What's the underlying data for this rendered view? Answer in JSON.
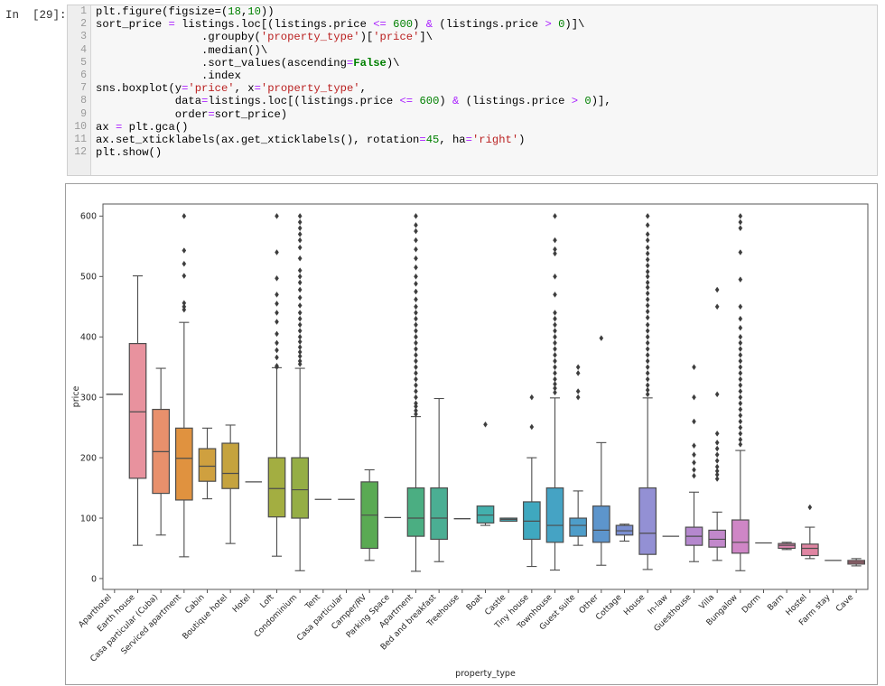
{
  "notebook": {
    "prompt": "In  [29]:",
    "line_numbers": [
      "1",
      "2",
      "3",
      "4",
      "5",
      "6",
      "7",
      "8",
      "9",
      "10",
      "11",
      "12"
    ],
    "code_lines": [
      [
        {
          "t": "plt.figure(figsize=",
          "c": "p"
        },
        {
          "t": "(",
          "c": "p"
        },
        {
          "t": "18",
          "c": "n"
        },
        {
          "t": ",",
          "c": "p"
        },
        {
          "t": "10",
          "c": "n"
        },
        {
          "t": "))",
          "c": "p"
        }
      ],
      [
        {
          "t": "sort_price ",
          "c": "p"
        },
        {
          "t": "=",
          "c": "o"
        },
        {
          "t": " listings.loc[(listings.price ",
          "c": "p"
        },
        {
          "t": "<=",
          "c": "o"
        },
        {
          "t": " ",
          "c": "p"
        },
        {
          "t": "600",
          "c": "n"
        },
        {
          "t": ") ",
          "c": "p"
        },
        {
          "t": "&",
          "c": "o"
        },
        {
          "t": " (listings.price ",
          "c": "p"
        },
        {
          "t": ">",
          "c": "o"
        },
        {
          "t": " ",
          "c": "p"
        },
        {
          "t": "0",
          "c": "n"
        },
        {
          "t": ")]\\",
          "c": "p"
        }
      ],
      [
        {
          "t": "                .groupby(",
          "c": "p"
        },
        {
          "t": "'property_type'",
          "c": "s"
        },
        {
          "t": ")[",
          "c": "p"
        },
        {
          "t": "'price'",
          "c": "s"
        },
        {
          "t": "]\\",
          "c": "p"
        }
      ],
      [
        {
          "t": "                .median()\\",
          "c": "p"
        }
      ],
      [
        {
          "t": "                .sort_values(ascending",
          "c": "p"
        },
        {
          "t": "=",
          "c": "o"
        },
        {
          "t": "False",
          "c": "k"
        },
        {
          "t": ")\\",
          "c": "p"
        }
      ],
      [
        {
          "t": "                .index",
          "c": "p"
        }
      ],
      [
        {
          "t": "sns.boxplot(y",
          "c": "p"
        },
        {
          "t": "=",
          "c": "o"
        },
        {
          "t": "'price'",
          "c": "s"
        },
        {
          "t": ", x",
          "c": "p"
        },
        {
          "t": "=",
          "c": "o"
        },
        {
          "t": "'property_type'",
          "c": "s"
        },
        {
          "t": ",",
          "c": "p"
        }
      ],
      [
        {
          "t": "            data",
          "c": "p"
        },
        {
          "t": "=",
          "c": "o"
        },
        {
          "t": "listings.loc[(listings.price ",
          "c": "p"
        },
        {
          "t": "<=",
          "c": "o"
        },
        {
          "t": " ",
          "c": "p"
        },
        {
          "t": "600",
          "c": "n"
        },
        {
          "t": ") ",
          "c": "p"
        },
        {
          "t": "&",
          "c": "o"
        },
        {
          "t": " (listings.price ",
          "c": "p"
        },
        {
          "t": ">",
          "c": "o"
        },
        {
          "t": " ",
          "c": "p"
        },
        {
          "t": "0",
          "c": "n"
        },
        {
          "t": ")],",
          "c": "p"
        }
      ],
      [
        {
          "t": "            order",
          "c": "p"
        },
        {
          "t": "=",
          "c": "o"
        },
        {
          "t": "sort_price)",
          "c": "p"
        }
      ],
      [
        {
          "t": "ax ",
          "c": "p"
        },
        {
          "t": "=",
          "c": "o"
        },
        {
          "t": " plt.gca()",
          "c": "p"
        }
      ],
      [
        {
          "t": "ax.set_xticklabels(ax.get_xticklabels(), rotation",
          "c": "p"
        },
        {
          "t": "=",
          "c": "o"
        },
        {
          "t": "45",
          "c": "n"
        },
        {
          "t": ", ha",
          "c": "p"
        },
        {
          "t": "=",
          "c": "o"
        },
        {
          "t": "'right'",
          "c": "s"
        },
        {
          "t": ")",
          "c": "p"
        }
      ],
      [
        {
          "t": "plt.show()",
          "c": "p"
        }
      ]
    ]
  },
  "chart_data": {
    "type": "box",
    "title": "",
    "xlabel": "property_type",
    "ylabel": "price",
    "ylim": [
      -18,
      620
    ],
    "yticks": [
      0,
      100,
      200,
      300,
      400,
      500,
      600
    ],
    "grid": false,
    "categories": [
      "Aparthotel",
      "Earth house",
      "Casa particular (Cuba)",
      "Serviced apartment",
      "Cabin",
      "Boutique hotel",
      "Hotel",
      "Loft",
      "Condominium",
      "Tent",
      "Casa particular",
      "Camper/RV",
      "Parking Space",
      "Apartment",
      "Bed and breakfast",
      "Treehouse",
      "Boat",
      "Castle",
      "Tiny house",
      "Townhouse",
      "Guest suite",
      "Other",
      "Cottage",
      "House",
      "In-law",
      "Guesthouse",
      "Villa",
      "Bungalow",
      "Dorm",
      "Barn",
      "Hostel",
      "Farm stay",
      "Cave"
    ],
    "colors": [
      "#e8929e",
      "#e8929e",
      "#e8906c",
      "#e0923f",
      "#cfa03f",
      "#c5a33e",
      "#b5ab3e",
      "#a3ae41",
      "#95ae45",
      "#7fae45",
      "#69ad4a",
      "#5aaa53",
      "#4eac6e",
      "#4bae82",
      "#4bae93",
      "#4badа3",
      "#43b0ad",
      "#3fadb8",
      "#3fa8bf",
      "#45a3c4",
      "#4e9dc9",
      "#5d95cc",
      "#7b8fd1",
      "#9390d4",
      "#a68bd2",
      "#b588ce",
      "#c288cb",
      "#cf86c6",
      "#d885bc",
      "#dd85ae",
      "#e085a2",
      "#e1859a",
      "#c96f80"
    ],
    "boxes": [
      {
        "cat": "Aparthotel",
        "q1": 305,
        "med": 305,
        "q3": 305,
        "low": 305,
        "high": 305,
        "outliers": []
      },
      {
        "cat": "Earth house",
        "q1": 166,
        "med": 276,
        "q3": 389,
        "low": 55,
        "high": 501,
        "outliers": []
      },
      {
        "cat": "Casa particular (Cuba)",
        "q1": 141,
        "med": 210,
        "q3": 280,
        "low": 72,
        "high": 348,
        "outliers": []
      },
      {
        "cat": "Serviced apartment",
        "q1": 130,
        "med": 199,
        "q3": 249,
        "low": 36,
        "high": 424,
        "outliers": [
          600,
          543,
          521,
          501,
          456,
          450,
          445
        ]
      },
      {
        "cat": "Cabin",
        "q1": 161,
        "med": 186,
        "q3": 215,
        "low": 132,
        "high": 249,
        "outliers": []
      },
      {
        "cat": "Boutique hotel",
        "q1": 149,
        "med": 174,
        "q3": 224,
        "low": 58,
        "high": 254,
        "outliers": []
      },
      {
        "cat": "Hotel",
        "q1": 160,
        "med": 160,
        "q3": 160,
        "low": 160,
        "high": 160,
        "outliers": []
      },
      {
        "cat": "Loft",
        "q1": 102,
        "med": 149,
        "q3": 200,
        "low": 37,
        "high": 349,
        "outliers": [
          600,
          540,
          497,
          470,
          455,
          440,
          425,
          405,
          390,
          378,
          366,
          352,
          350
        ]
      },
      {
        "cat": "Condominium",
        "q1": 100,
        "med": 147,
        "q3": 200,
        "low": 13,
        "high": 348,
        "outliers": [
          600,
          590,
          580,
          570,
          560,
          548,
          530,
          510,
          500,
          490,
          478,
          465,
          452,
          440,
          430,
          420,
          410,
          400,
          392,
          383,
          375,
          368,
          360,
          355
        ]
      },
      {
        "cat": "Tent",
        "q1": 131,
        "med": 131,
        "q3": 131,
        "low": 131,
        "high": 131,
        "outliers": []
      },
      {
        "cat": "Casa particular",
        "q1": 131,
        "med": 131,
        "q3": 131,
        "low": 131,
        "high": 131,
        "outliers": []
      },
      {
        "cat": "Camper/RV",
        "q1": 50,
        "med": 105,
        "q3": 160,
        "low": 30,
        "high": 180,
        "outliers": []
      },
      {
        "cat": "Parking Space",
        "q1": 101,
        "med": 101,
        "q3": 101,
        "low": 101,
        "high": 101,
        "outliers": []
      },
      {
        "cat": "Apartment",
        "q1": 70,
        "med": 100,
        "q3": 150,
        "low": 12,
        "high": 268,
        "outliers": [
          600,
          585,
          575,
          560,
          545,
          530,
          515,
          500,
          488,
          475,
          462,
          450,
          440,
          430,
          420,
          410,
          400,
          390,
          380,
          370,
          360,
          350,
          340,
          330,
          320,
          310,
          300,
          290,
          285,
          278,
          272
        ]
      },
      {
        "cat": "Bed and breakfast",
        "q1": 65,
        "med": 100,
        "q3": 150,
        "low": 28,
        "high": 298,
        "outliers": []
      },
      {
        "cat": "Treehouse",
        "q1": 99,
        "med": 99,
        "q3": 99,
        "low": 99,
        "high": 99,
        "outliers": []
      },
      {
        "cat": "Boat",
        "q1": 92,
        "med": 105,
        "q3": 120,
        "low": 88,
        "high": 120,
        "outliers": [
          255
        ]
      },
      {
        "cat": "Castle",
        "q1": 95,
        "med": 98,
        "q3": 100,
        "low": 95,
        "high": 100,
        "outliers": []
      },
      {
        "cat": "Tiny house",
        "q1": 65,
        "med": 95,
        "q3": 127,
        "low": 20,
        "high": 200,
        "outliers": [
          300,
          251
        ]
      },
      {
        "cat": "Townhouse",
        "q1": 60,
        "med": 88,
        "q3": 150,
        "low": 14,
        "high": 299,
        "outliers": [
          600,
          560,
          545,
          538,
          500,
          470,
          440,
          430,
          420,
          410,
          400,
          390,
          380,
          370,
          360,
          350,
          340,
          330,
          322,
          315,
          308
        ]
      },
      {
        "cat": "Guest suite",
        "q1": 70,
        "med": 88,
        "q3": 100,
        "low": 55,
        "high": 145,
        "outliers": [
          350,
          340,
          310,
          300
        ]
      },
      {
        "cat": "Other",
        "q1": 60,
        "med": 80,
        "q3": 120,
        "low": 22,
        "high": 225,
        "outliers": [
          398
        ]
      },
      {
        "cat": "Cottage",
        "q1": 72,
        "med": 79,
        "q3": 88,
        "low": 62,
        "high": 90,
        "outliers": []
      },
      {
        "cat": "House",
        "q1": 40,
        "med": 75,
        "q3": 150,
        "low": 15,
        "high": 299,
        "outliers": [
          600,
          585,
          570,
          560,
          548,
          538,
          528,
          518,
          508,
          500,
          490,
          482,
          472,
          462,
          452,
          442,
          432,
          420,
          410,
          400,
          390,
          380,
          370,
          360,
          350,
          340,
          330,
          320,
          312,
          305
        ]
      },
      {
        "cat": "In-law",
        "q1": 70,
        "med": 70,
        "q3": 70,
        "low": 70,
        "high": 70,
        "outliers": []
      },
      {
        "cat": "Guesthouse",
        "q1": 55,
        "med": 70,
        "q3": 85,
        "low": 28,
        "high": 143,
        "outliers": [
          350,
          300,
          260,
          220,
          205,
          192,
          180,
          170
        ]
      },
      {
        "cat": "Villa",
        "q1": 52,
        "med": 65,
        "q3": 80,
        "low": 30,
        "high": 110,
        "outliers": [
          478,
          450,
          305,
          240,
          225,
          215,
          205,
          195,
          185,
          178,
          172,
          165
        ]
      },
      {
        "cat": "Bungalow",
        "q1": 42,
        "med": 60,
        "q3": 97,
        "low": 13,
        "high": 212,
        "outliers": [
          600,
          590,
          580,
          540,
          495,
          450,
          430,
          415,
          400,
          390,
          380,
          370,
          360,
          350,
          340,
          330,
          320,
          310,
          300,
          290,
          280,
          270,
          260,
          250,
          240,
          230,
          222
        ]
      },
      {
        "cat": "Dorm",
        "q1": 59,
        "med": 59,
        "q3": 59,
        "low": 59,
        "high": 59,
        "outliers": []
      },
      {
        "cat": "Barn",
        "q1": 50,
        "med": 55,
        "q3": 58,
        "low": 48,
        "high": 60,
        "outliers": []
      },
      {
        "cat": "Hostel",
        "q1": 38,
        "med": 50,
        "q3": 57,
        "low": 33,
        "high": 85,
        "outliers": [
          118
        ]
      },
      {
        "cat": "Farm stay",
        "q1": 30,
        "med": 30,
        "q3": 30,
        "low": 30,
        "high": 30,
        "outliers": []
      },
      {
        "cat": "Cave",
        "q1": 24,
        "med": 27,
        "q3": 30,
        "low": 21,
        "high": 33,
        "outliers": []
      }
    ]
  }
}
